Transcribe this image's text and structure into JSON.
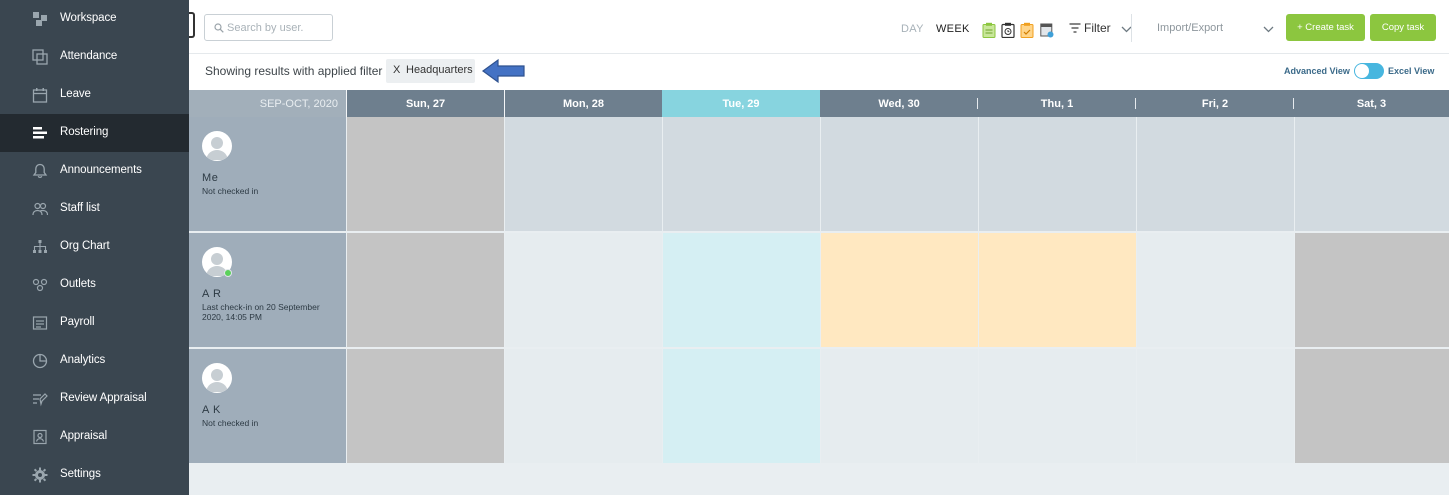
{
  "sidebar": {
    "items": [
      {
        "label": "Workspace",
        "icon": "workspace-icon"
      },
      {
        "label": "Attendance",
        "icon": "attendance-icon"
      },
      {
        "label": "Leave",
        "icon": "calendar-icon"
      },
      {
        "label": "Rostering",
        "icon": "rostering-icon",
        "active": true
      },
      {
        "label": "Announcements",
        "icon": "bell-icon"
      },
      {
        "label": "Staff list",
        "icon": "staff-icon"
      },
      {
        "label": "Org Chart",
        "icon": "org-chart-icon"
      },
      {
        "label": "Outlets",
        "icon": "outlets-icon"
      },
      {
        "label": "Payroll",
        "icon": "payroll-icon"
      },
      {
        "label": "Analytics",
        "icon": "analytics-icon"
      },
      {
        "label": "Review Appraisal",
        "icon": "review-icon"
      },
      {
        "label": "Appraisal",
        "icon": "appraisal-icon"
      },
      {
        "label": "Settings",
        "icon": "gear-icon"
      }
    ]
  },
  "topbar": {
    "search_placeholder": "Search by user.",
    "view_day": "DAY",
    "view_week": "WEEK",
    "filter_label": "Filter",
    "import_export": "Import/Export",
    "create_task": "+ Create task",
    "copy_task": "Copy task"
  },
  "filterbar": {
    "text": "Showing results with applied filter :",
    "chip_close": "X",
    "chip_label": "Headquarters",
    "advanced_view": "Advanced View",
    "excel_view": "Excel View"
  },
  "grid": {
    "month_label": "SEP-OCT, 2020",
    "days": [
      "Sun, 27",
      "Mon, 28",
      "Tue, 29",
      "Wed, 30",
      "Thu, 1",
      "Fri, 2",
      "Sat, 3"
    ],
    "today_index": 2,
    "rows": [
      {
        "name": "Me",
        "status": "Not checked in",
        "online": false
      },
      {
        "name": "A R",
        "status": "Last check-in on 20 September 2020, 14:05 PM",
        "online": true
      },
      {
        "name": "A K",
        "status": "Not checked in",
        "online": false
      }
    ]
  },
  "colors": {
    "sidebar_bg": "#3a4650",
    "sidebar_active": "#232a30",
    "header_bg": "#6e7f8e",
    "today_header": "#87d4df",
    "weekend_cell": "#c4c4c4",
    "leave_cell": "#ffe8c1",
    "today_cell": "#d5eff3",
    "accent_green": "#8cc63f",
    "toggle_blue": "#47b6df"
  }
}
